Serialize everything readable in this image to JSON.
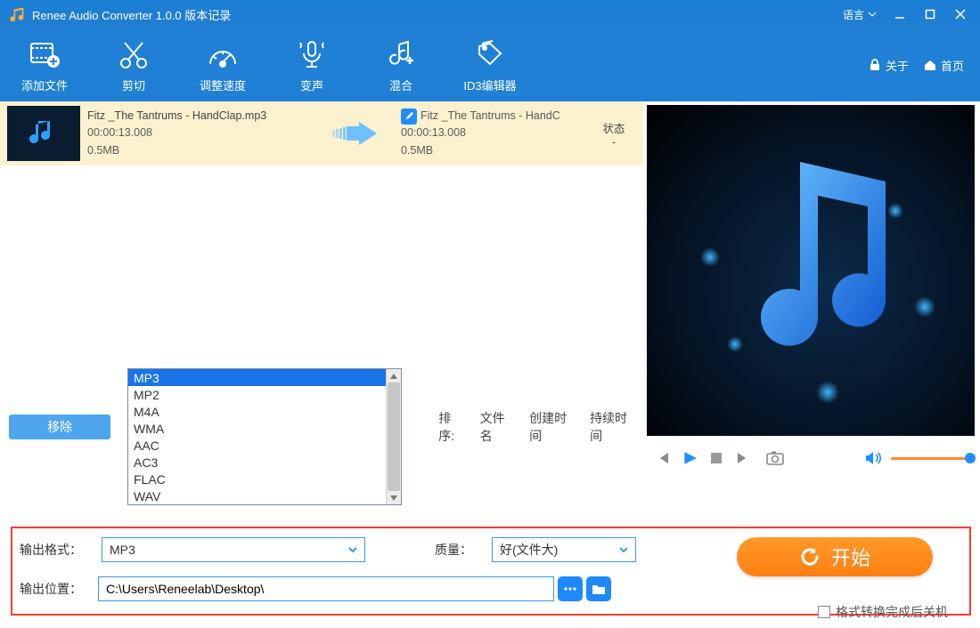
{
  "titlebar": {
    "title": "Renee Audio Converter 1.0.0 版本记录",
    "language": "语言"
  },
  "toolbar": {
    "add": "添加文件",
    "cut": "剪切",
    "speed": "调整速度",
    "voice": "变声",
    "mix": "混合",
    "id3": "ID3编辑器",
    "about": "关于",
    "home": "首页"
  },
  "file_list": [
    {
      "src_name": "Fitz _The Tantrums - HandClap.mp3",
      "src_duration": "00:00:13.008",
      "src_size": "0.5MB",
      "dst_name": "Fitz _The Tantrums - HandC",
      "dst_duration": "00:00:13.008",
      "dst_size": "0.5MB",
      "state_header": "状态",
      "state_value": "-"
    }
  ],
  "remove_label": "移除",
  "sort": {
    "label": "排序:",
    "by_name": "文件名",
    "by_created": "创建时间",
    "by_duration": "持续时间"
  },
  "format_options": [
    "MP3",
    "MP2",
    "M4A",
    "WMA",
    "AAC",
    "AC3",
    "FLAC",
    "WAV"
  ],
  "format_selected": "MP3",
  "output": {
    "format_label": "输出格式：",
    "format_value": "MP3",
    "quality_label": "质量：",
    "quality_value": "好(文件大)",
    "location_label": "输出位置：",
    "location_value": "C:\\Users\\Reneelab\\Desktop\\"
  },
  "start_label": "开始",
  "shutdown_after": "格式转换完成后关机"
}
